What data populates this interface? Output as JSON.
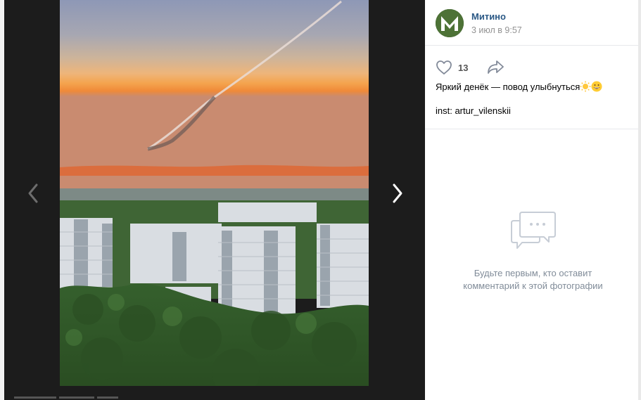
{
  "post": {
    "group_name": "Митино",
    "date": "3 июл в 9:57",
    "likes": "13",
    "text_line1": "Яркий денёк — повод улыбнуться",
    "text_line2": "inst: artur_vilenskii"
  },
  "comments": {
    "empty_line1": "Будьте первым, кто оставит",
    "empty_line2": "комментарий к этой фотографии"
  },
  "icons": {
    "prev": "chevron-left-icon",
    "next": "chevron-right-icon",
    "like": "heart-icon",
    "share": "share-arrow-icon",
    "comments": "chat-bubbles-icon",
    "sun_emoji": "sun-emoji",
    "smile_emoji": "grinning-face-emoji"
  },
  "colors": {
    "link": "#2a5885",
    "muted": "#939393",
    "empty_text": "#818c99",
    "icon": "#828a99"
  }
}
